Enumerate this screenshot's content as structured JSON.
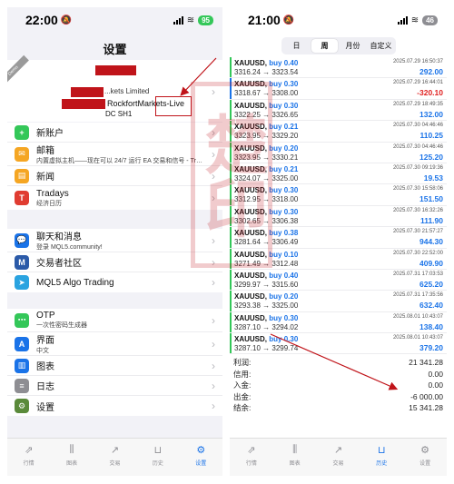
{
  "left": {
    "status": {
      "time": "22:00",
      "battery": "95"
    },
    "title": "设置",
    "account": {
      "ribbon": "Demo",
      "server_partial": "...kets Limited",
      "server_line": "RockfortMarkets-Live",
      "account_line": "DC SH1"
    },
    "group1": [
      {
        "icon": "add-user-icon",
        "title": "新账户",
        "sub": "",
        "color": "#34c759",
        "glyph": "+"
      },
      {
        "icon": "mail-icon",
        "title": "邮箱",
        "sub": "内置虚拟主机——现在可以 24/7 运行 EA 交易和信号 - Tradin…",
        "color": "#f5a623",
        "glyph": "✉"
      },
      {
        "icon": "news-icon",
        "title": "新闻",
        "sub": "",
        "color": "#f5a623",
        "glyph": "▤"
      },
      {
        "icon": "tradays-icon",
        "title": "Tradays",
        "sub": "经济日历",
        "color": "#e03c31",
        "glyph": "T"
      }
    ],
    "group2": [
      {
        "icon": "chat-icon",
        "title": "聊天和消息",
        "sub": "登录 MQL5.community!",
        "color": "#1a73e8",
        "glyph": "💬"
      },
      {
        "icon": "community-icon",
        "title": "交易者社区",
        "sub": "",
        "color": "#2b5aa8",
        "glyph": "M"
      },
      {
        "icon": "telegram-icon",
        "title": "MQL5 Algo Trading",
        "sub": "",
        "color": "#2aa3e0",
        "glyph": "➤"
      }
    ],
    "group3": [
      {
        "icon": "otp-icon",
        "title": "OTP",
        "sub": "一次性密码生成器",
        "color": "#34c759",
        "glyph": "⋯"
      },
      {
        "icon": "language-icon",
        "title": "界面",
        "sub": "中文",
        "color": "#1a73e8",
        "glyph": "A"
      },
      {
        "icon": "chart-icon",
        "title": "图表",
        "sub": "",
        "color": "#1a73e8",
        "glyph": "▥"
      },
      {
        "icon": "journal-icon",
        "title": "日志",
        "sub": "",
        "color": "#8e8e93",
        "glyph": "≡"
      },
      {
        "icon": "settings-icon",
        "title": "设置",
        "sub": "",
        "color": "#5a8a3a",
        "glyph": "⚙"
      }
    ],
    "tabs": [
      "行情",
      "图表",
      "交易",
      "历史",
      "设置"
    ],
    "active_tab": 4
  },
  "right": {
    "status": {
      "time": "21:00",
      "battery": "46"
    },
    "periods": [
      "日",
      "周",
      "月份",
      "自定义"
    ],
    "active_period": 1,
    "trades": [
      {
        "symbol": "XAUUSD,",
        "side": "buy 0.40",
        "open": "3316.24",
        "close": "3323.54",
        "time": "2025.07.29 16:50:37",
        "profit": "292.00",
        "positive": true
      },
      {
        "symbol": "XAUUSD,",
        "side": "buy 0.30",
        "open": "3318.67",
        "close": "3308.00",
        "time": "2025.07.29 16:44:01",
        "profit": "-320.10",
        "positive": false
      },
      {
        "symbol": "XAUUSD,",
        "side": "buy 0.30",
        "open": "3322.25",
        "close": "3326.65",
        "time": "2025.07.29 18:49:35",
        "profit": "132.00",
        "positive": true
      },
      {
        "symbol": "XAUUSD,",
        "side": "buy 0.21",
        "open": "3323.95",
        "close": "3329.20",
        "time": "2025.07.30 04:46:46",
        "profit": "110.25",
        "positive": true
      },
      {
        "symbol": "XAUUSD,",
        "side": "buy 0.20",
        "open": "3323.95",
        "close": "3330.21",
        "time": "2025.07.30 04:46:46",
        "profit": "125.20",
        "positive": true
      },
      {
        "symbol": "XAUUSD,",
        "side": "buy 0.21",
        "open": "3324.07",
        "close": "3325.00",
        "time": "2025.07.30 09:19:36",
        "profit": "19.53",
        "positive": true
      },
      {
        "symbol": "XAUUSD,",
        "side": "buy 0.30",
        "open": "3312.95",
        "close": "3318.00",
        "time": "2025.07.30 15:58:06",
        "profit": "151.50",
        "positive": true
      },
      {
        "symbol": "XAUUSD,",
        "side": "buy 0.30",
        "open": "3302.65",
        "close": "3306.38",
        "time": "2025.07.30 16:32:26",
        "profit": "111.90",
        "positive": true
      },
      {
        "symbol": "XAUUSD,",
        "side": "buy 0.38",
        "open": "3281.64",
        "close": "3306.49",
        "time": "2025.07.30 21:57:27",
        "profit": "944.30",
        "positive": true
      },
      {
        "symbol": "XAUUSD,",
        "side": "buy 0.10",
        "open": "3271.49",
        "close": "3312.48",
        "time": "2025.07.30 22:52:00",
        "profit": "409.90",
        "positive": true
      },
      {
        "symbol": "XAUUSD,",
        "side": "buy 0.40",
        "open": "3299.97",
        "close": "3315.60",
        "time": "2025.07.31 17:03:53",
        "profit": "625.20",
        "positive": true
      },
      {
        "symbol": "XAUUSD,",
        "side": "buy 0.20",
        "open": "3293.38",
        "close": "3325.00",
        "time": "2025.07.31 17:35:56",
        "profit": "632.40",
        "positive": true
      },
      {
        "symbol": "XAUUSD,",
        "side": "buy 0.30",
        "open": "3287.10",
        "close": "3294.02",
        "time": "2025.08.01 10:43:07",
        "profit": "138.40",
        "positive": true
      },
      {
        "symbol": "XAUUSD,",
        "side": "buy 0.30",
        "open": "3287.10",
        "close": "3299.74",
        "time": "2025.08.01 10:43:07",
        "profit": "379.20",
        "positive": true
      }
    ],
    "summary": [
      {
        "label": "利润:",
        "value": "21 341.28"
      },
      {
        "label": "信用:",
        "value": "0.00"
      },
      {
        "label": "入金:",
        "value": "0.00"
      },
      {
        "label": "出金:",
        "value": "-6 000.00"
      },
      {
        "label": "结余:",
        "value": "15 341.28"
      }
    ],
    "tabs": [
      "行情",
      "图表",
      "交易",
      "历史",
      "设置"
    ],
    "active_tab": 3
  },
  "colors": {
    "accent": "#1a73e8",
    "loss": "#e02020",
    "annotation": "#c0141a",
    "blue_edge": "#1a73e8",
    "green_edge": "#34c759"
  },
  "watermark": {
    "text": "楚印"
  }
}
